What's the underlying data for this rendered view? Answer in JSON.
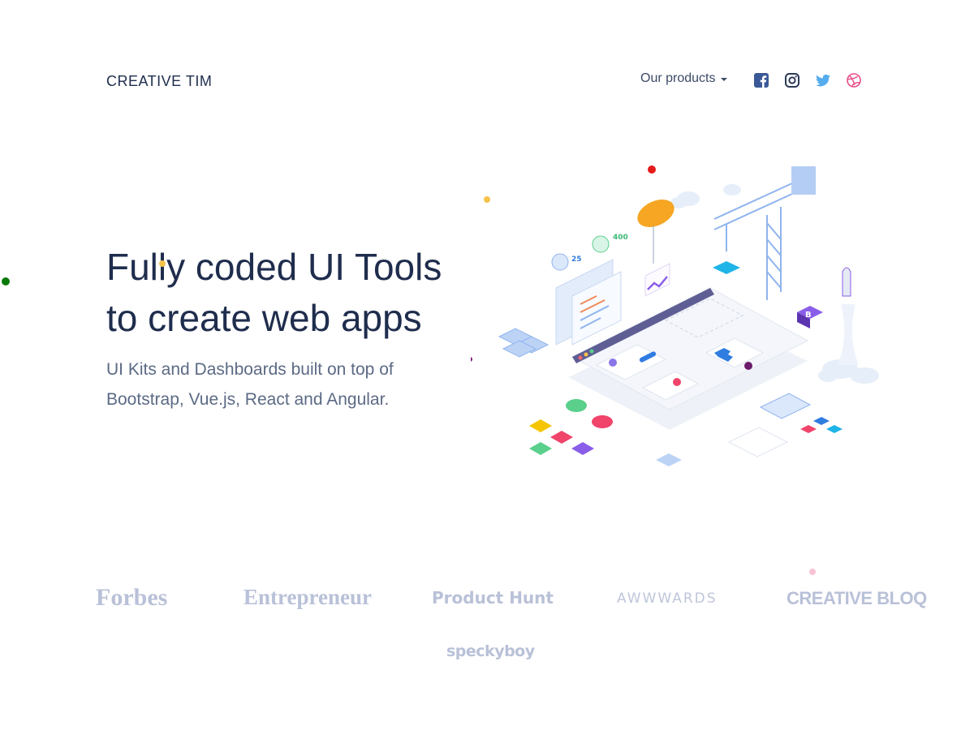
{
  "header": {
    "brand": "CREATIVE TIM",
    "nav_products": "Our products",
    "social": [
      {
        "icon": "facebook-icon"
      },
      {
        "icon": "instagram-icon"
      },
      {
        "icon": "twitter-icon"
      },
      {
        "icon": "dribbble-icon"
      }
    ]
  },
  "hero": {
    "title_line1": "Fully coded UI Tools",
    "title_line2": "to create web apps",
    "subtitle_line1": "UI Kits and Dashboards built on top of",
    "subtitle_line2": "Bootstrap, Vue.js, React and Angular."
  },
  "illustration": {
    "labels": [
      "25",
      "400",
      "B"
    ]
  },
  "press": {
    "logos": [
      "Forbes",
      "Entrepreneur",
      "Product Hunt",
      "AWWWARDS",
      "CREATIVE BLOQ",
      "speckyboy"
    ]
  },
  "colors": {
    "heading": "#1f2d4d",
    "subtitle": "#5c6a85",
    "press_logo": "#b9c1d8",
    "facebook": "#3b5998",
    "twitter": "#55acee",
    "dribbble": "#ea4c89",
    "crane": "#8fb4ee"
  }
}
